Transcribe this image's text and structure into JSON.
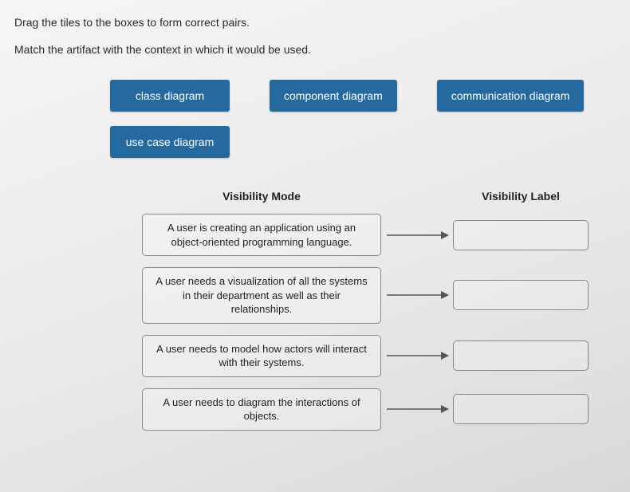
{
  "instructions": {
    "line1": "Drag the tiles to the boxes to form correct pairs.",
    "line2": "Match the artifact with the context in which it would be used."
  },
  "tiles": {
    "class": "class diagram",
    "component": "component diagram",
    "communication": "communication diagram",
    "usecase": "use case diagram"
  },
  "columns": {
    "mode": "Visibility Mode",
    "label": "Visibility Label"
  },
  "rows": [
    {
      "mode": "A user is creating an application using an object-oriented programming language."
    },
    {
      "mode": "A user needs a visualization of all the systems in their department as well as their relationships."
    },
    {
      "mode": "A user needs to model how actors will interact with their systems."
    },
    {
      "mode": "A user needs to diagram the interactions of objects."
    }
  ]
}
